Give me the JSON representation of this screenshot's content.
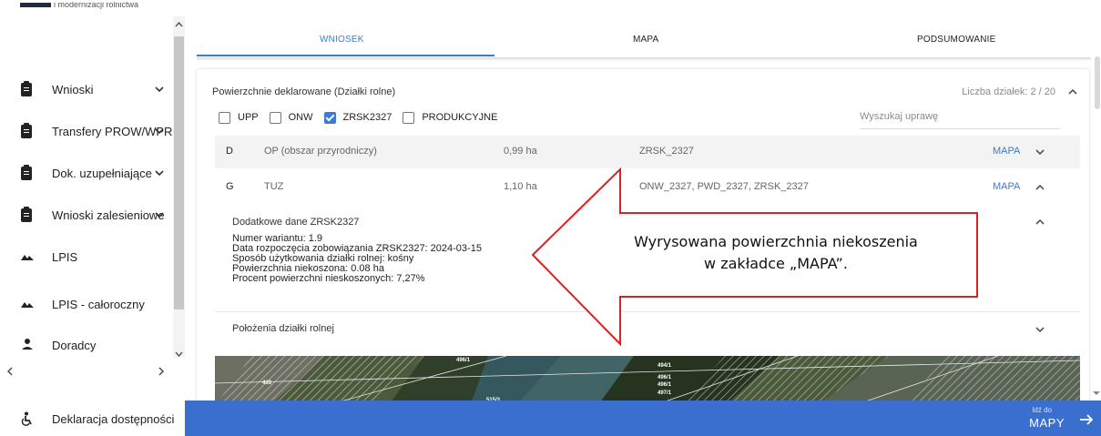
{
  "sidebar": {
    "top_text": "i modernizacji rolnictwa",
    "items": [
      {
        "label": "Wnioski",
        "icon": "clipboard-icon",
        "chevron": true
      },
      {
        "label": "Transfery PROW/WPR",
        "icon": "clipboard-icon",
        "chevron": true
      },
      {
        "label": "Dok. uzupełniające",
        "icon": "clipboard-icon",
        "chevron": true
      },
      {
        "label": "Wnioski zalesieniowe",
        "icon": "clipboard-icon",
        "chevron": true
      },
      {
        "label": "LPIS",
        "icon": "mountain-icon",
        "chevron": false
      },
      {
        "label": "LPIS - całoroczny",
        "icon": "mountain-icon",
        "chevron": false
      },
      {
        "label": "Doradcy",
        "icon": "person-icon",
        "chevron": false
      }
    ],
    "accessibility_label": "Deklaracja dostępności"
  },
  "tabs": [
    "WNIOSEK",
    "MAPA",
    "PODSUMOWANIE"
  ],
  "active_tab": "WNIOSEK",
  "section": {
    "title": "Powierzchnie deklarowane (Działki rolne)",
    "count": "Liczba działek: 2 / 20",
    "filters": [
      {
        "label": "UPP",
        "checked": false
      },
      {
        "label": "ONW",
        "checked": false
      },
      {
        "label": "ZRSK2327",
        "checked": true
      },
      {
        "label": "PRODUKCYJNE",
        "checked": false
      }
    ],
    "search_placeholder": "Wyszukaj uprawę"
  },
  "rows": [
    {
      "letter": "D",
      "name": "OP (obszar przyrodniczy)",
      "area": "0,99 ha",
      "codes": "ZRSK_2327",
      "link": "MAPA",
      "expanded": false
    },
    {
      "letter": "G",
      "name": "TUZ",
      "area": "1,10 ha",
      "codes": "ONW_2327, PWD_2327, ZRSK_2327",
      "link": "MAPA",
      "expanded": true
    }
  ],
  "detail": {
    "title": "Dodatkowe dane ZRSK2327",
    "lines": [
      "Numer wariantu: 1.9",
      "Data rozpoczęcia zobowiązania ZRSK2327: 2024-03-15",
      "Sposób użytkowania działki rolnej: kośny",
      "Powierzchnia niekoszona: 0.08 ha",
      "Procent powierzchni nieskoszonych: 7,27%"
    ],
    "location_label": "Położenia działki rolnej"
  },
  "map_labels": [
    "496/1",
    "494/1",
    "496/1",
    "496/1",
    "497/1",
    "433",
    "515/3"
  ],
  "bottom_bar": {
    "small": "Idź do",
    "big": "MAPY"
  },
  "callout": {
    "line1": "Wyrysowana powierzchnia niekoszenia",
    "line2": "w zakładce „MAPA”."
  },
  "colors": {
    "accent": "#3a7bd5",
    "bottom_bar": "#3b6fcf",
    "callout_border": "#e02020"
  }
}
